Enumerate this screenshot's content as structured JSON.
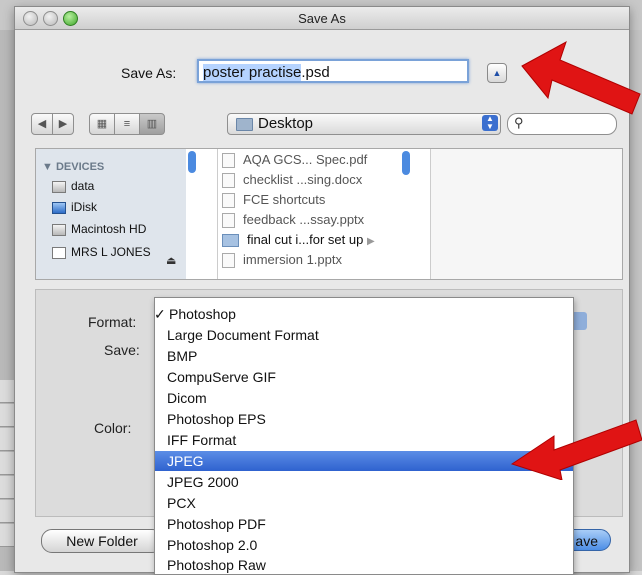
{
  "window": {
    "title": "Save As"
  },
  "save_as": {
    "label": "Save As:",
    "filename": "poster practise",
    "extension": ".psd"
  },
  "toolbar": {
    "location": "Desktop",
    "search_placeholder": ""
  },
  "sidebar": {
    "header": "DEVICES",
    "items": [
      {
        "label": "data"
      },
      {
        "label": "iDisk"
      },
      {
        "label": "Macintosh HD"
      },
      {
        "label": "MRS L JONES"
      }
    ]
  },
  "files": [
    {
      "name": "AQA GCS... Spec.pdf",
      "type": "doc"
    },
    {
      "name": "checklist ...sing.docx",
      "type": "doc"
    },
    {
      "name": "FCE shortcuts",
      "type": "doc"
    },
    {
      "name": "feedback ...ssay.pptx",
      "type": "doc"
    },
    {
      "name": "final cut i...for set up",
      "type": "folder"
    },
    {
      "name": "immersion 1.pptx",
      "type": "doc"
    }
  ],
  "options": {
    "format_label": "Format:",
    "save_label": "Save:",
    "color_label": "Color:"
  },
  "format_menu": {
    "selected": "Photoshop",
    "highlighted": "JPEG",
    "items": [
      "Photoshop",
      "Large Document Format",
      "BMP",
      "CompuServe GIF",
      "Dicom",
      "Photoshop EPS",
      "IFF Format",
      "JPEG",
      "JPEG 2000",
      "PCX",
      "Photoshop PDF",
      "Photoshop 2.0",
      "Photoshop Raw"
    ]
  },
  "buttons": {
    "new_folder": "New Folder",
    "save": "ave"
  },
  "colors": {
    "accent": "#2f62cf",
    "arrow": "#e01414"
  }
}
